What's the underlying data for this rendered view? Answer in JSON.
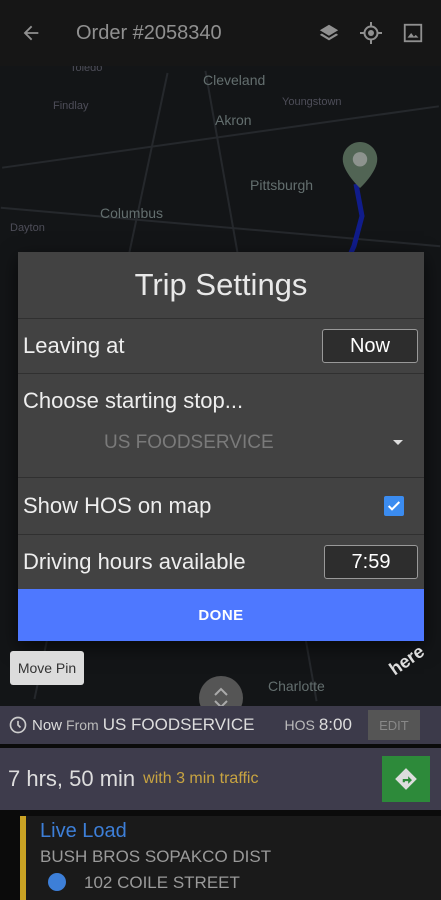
{
  "header": {
    "title": "Order #2058340"
  },
  "map": {
    "cities": [
      {
        "label": "Toledo",
        "cls": "small"
      },
      {
        "label": "Cleveland",
        "cls": ""
      },
      {
        "label": "Findlay",
        "cls": "small"
      },
      {
        "label": "Akron",
        "cls": ""
      },
      {
        "label": "Youngstown",
        "cls": "small"
      },
      {
        "label": "Pittsburgh",
        "cls": ""
      },
      {
        "label": "Columbus",
        "cls": ""
      },
      {
        "label": "Dayton",
        "cls": "small"
      },
      {
        "label": "Charlotte",
        "cls": ""
      }
    ]
  },
  "dialog": {
    "title": "Trip Settings",
    "leaving_label": "Leaving at",
    "leaving_value": "Now",
    "choose_label": "Choose starting stop...",
    "choose_value": "US FOODSERVICE",
    "hos_label": "Show HOS on map",
    "hos_checked": true,
    "driving_label": "Driving hours available",
    "driving_value": "7:59",
    "done_label": "DONE"
  },
  "map_controls": {
    "move_pin": "Move Pin",
    "watermark": "here"
  },
  "info": {
    "now": "Now",
    "from_label": "From",
    "start_stop": "US FOODSERVICE",
    "hos_label": "HOS",
    "hos_value": "8:00",
    "edit_label": "EDIT"
  },
  "eta": {
    "duration": "7 hrs, 50 min",
    "traffic": "with 3 min traffic"
  },
  "stop": {
    "type": "Live Load",
    "name": "BUSH BROS SOPAKCO DIST",
    "address": "102 COILE STREET"
  },
  "colors": {
    "accent": "#4e78ff",
    "checkbox": "#3b8cf0",
    "traffic": "#c8a441",
    "go_button": "#2d8a3a",
    "stop_bar": "#c9a224"
  }
}
